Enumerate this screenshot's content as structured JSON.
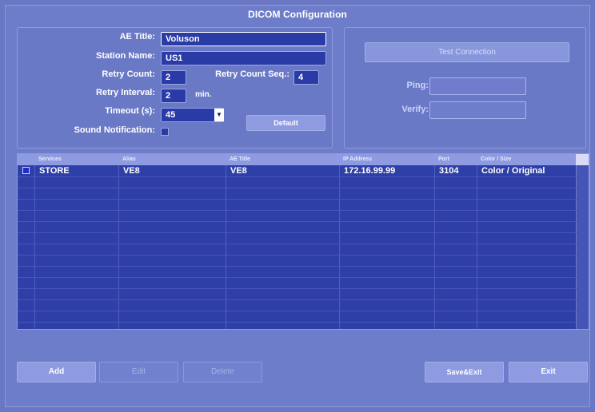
{
  "window": {
    "title": "DICOM Configuration"
  },
  "settings": {
    "ae_title": {
      "label": "AE Title:",
      "value": "Voluson"
    },
    "station_name": {
      "label": "Station Name:",
      "value": "US1"
    },
    "retry_count": {
      "label": "Retry Count:",
      "value": "2"
    },
    "retry_count_seq": {
      "label": "Retry Count Seq.:",
      "value": "4"
    },
    "retry_interval": {
      "label": "Retry Interval:",
      "value": "2",
      "unit": "min."
    },
    "timeout": {
      "label": "Timeout (s):",
      "value": "45"
    },
    "default_button": "Default",
    "sound_notification": {
      "label": "Sound Notification:",
      "checked": false
    }
  },
  "connection": {
    "test_button": "Test Connection",
    "ping_label": "Ping:",
    "ping_value": "",
    "verify_label": "Verify:",
    "verify_value": ""
  },
  "table": {
    "headers": [
      "Services",
      "Alias",
      "AE Title",
      "IP Address",
      "Port",
      "Color / Size"
    ],
    "rows": [
      {
        "service": "STORE",
        "alias": "VE8",
        "ae_title": "VE8",
        "ip": "172.16.99.99",
        "port": "3104",
        "color_size": "Color / Original"
      }
    ]
  },
  "buttons": {
    "add": "Add",
    "edit": "Edit",
    "delete": "Delete",
    "save_exit": "Save&Exit",
    "exit": "Exit"
  },
  "colors": {
    "background": "#6e7dca",
    "field": "#2a3aa6",
    "table_body": "#2f3fa8",
    "header": "#8e9be0"
  }
}
